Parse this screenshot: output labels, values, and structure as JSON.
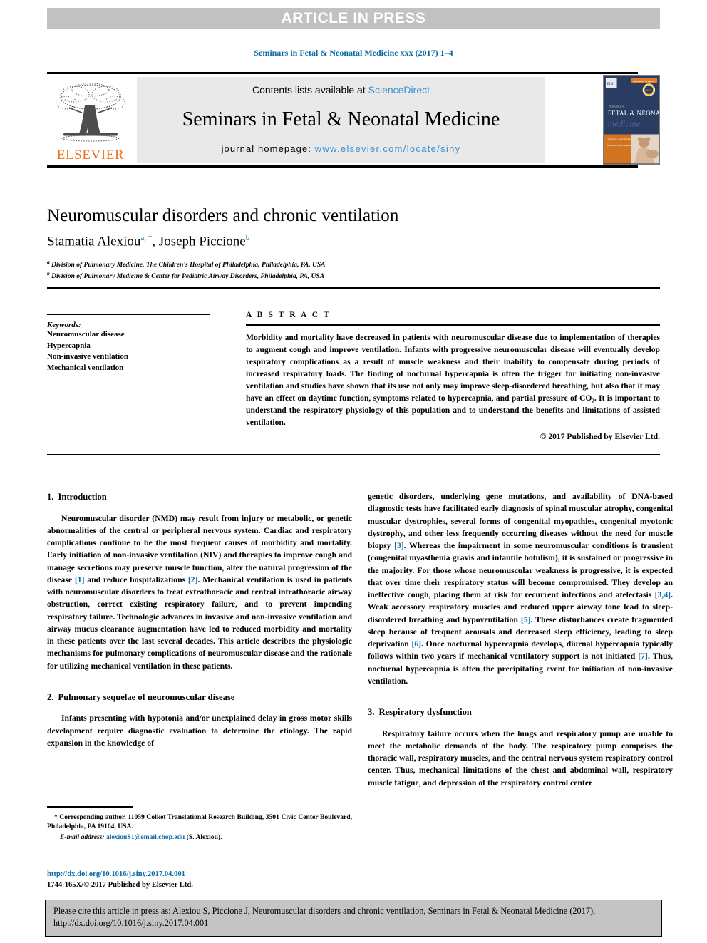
{
  "banner": {
    "text": "ARTICLE IN PRESS"
  },
  "running_head": {
    "text": "Seminars in Fetal & Neonatal Medicine xxx (2017) 1–4"
  },
  "masthead": {
    "contents_prefix": "Contents lists available at ",
    "contents_link": "ScienceDirect",
    "journal_name": "Seminars in Fetal & Neonatal Medicine",
    "homepage_label": "journal homepage: ",
    "homepage_url": "www.elsevier.com/locate/siny",
    "publisher_wordmark": "ELSEVIER",
    "cover_title_small": "Seminars in",
    "cover_title_main": "FETAL & NEONATAL",
    "cover_title_script": "medicine",
    "cover_band_text": "CHRONIC LUNG DISEASE",
    "cover_band_sub": "Guest Editor: Anne Greenough"
  },
  "article": {
    "title": "Neuromuscular disorders and chronic ventilation",
    "authors": [
      {
        "name": "Stamatia Alexiou",
        "marks": "a, *"
      },
      {
        "name": "Joseph Piccione",
        "marks": "b"
      }
    ],
    "affiliations": [
      {
        "mark": "a",
        "text": "Division of Pulmonary Medicine, The Children's Hospital of Philadelphia, Philadelphia, PA, USA"
      },
      {
        "mark": "b",
        "text": "Division of Pulmonary Medicine & Center for Pediatric Airway Disorders, Philadelphia, PA, USA"
      }
    ]
  },
  "keywords": {
    "heading": "Keywords:",
    "items": [
      "Neuromuscular disease",
      "Hypercapnia",
      "Non-invasive ventilation",
      "Mechanical ventilation"
    ]
  },
  "abstract": {
    "heading": "A B S T R A C T",
    "body": "Morbidity and mortality have decreased in patients with neuromuscular disease due to implementation of therapies to augment cough and improve ventilation. Infants with progressive neuromuscular disease will eventually develop respiratory complications as a result of muscle weakness and their inability to compensate during periods of increased respiratory loads. The finding of nocturnal hypercapnia is often the trigger for initiating non-invasive ventilation and studies have shown that its use not only may improve sleep-disordered breathing, but also that it may have an effect on daytime function, symptoms related to hypercapnia, and partial pressure of CO₂. It is important to understand the respiratory physiology of this population and to understand the benefits and limitations of assisted ventilation.",
    "copyright": "© 2017 Published by Elsevier Ltd."
  },
  "sections": {
    "intro": {
      "number": "1.",
      "title": "Introduction",
      "para1_a": "Neuromuscular disorder (NMD) may result from injury or metabolic, or genetic abnormalities of the central or peripheral nervous system. Cardiac and respiratory complications continue to be the most frequent causes of morbidity and mortality. Early initiation of non-invasive ventilation (NIV) and therapies to improve cough and manage secretions may preserve muscle function, alter the natural progression of the disease ",
      "ref1": "[1]",
      "para1_b": " and reduce hospitalizations ",
      "ref2": "[2]",
      "para1_c": ". Mechanical ventilation is used in patients with neuromuscular disorders to treat extrathoracic and central intrathoracic airway obstruction, correct existing respiratory failure, and to prevent impending respiratory failure. Technologic advances in invasive and non-invasive ventilation and airway mucus clearance augmentation have led to reduced morbidity and mortality in these patients over the last several decades. This article describes the physiologic mechanisms for pulmonary complications of neuromuscular disease and the rationale for utilizing mechanical ventilation in these patients."
    },
    "sequelae": {
      "number": "2.",
      "title": "Pulmonary sequelae of neuromuscular disease",
      "para1": "Infants presenting with hypotonia and/or unexplained delay in gross motor skills development require diagnostic evaluation to determine the etiology. The rapid expansion in the knowledge of"
    },
    "sequelae_cont": {
      "part_a": "genetic disorders, underlying gene mutations, and availability of DNA-based diagnostic tests have facilitated early diagnosis of spinal muscular atrophy, congenital muscular dystrophies, several forms of congenital myopathies, congenital myotonic dystrophy, and other less frequently occurring diseases without the need for muscle biopsy ",
      "ref3": "[3]",
      "part_b": ". Whereas the impairment in some neuromuscular conditions is transient (congenital myasthenia gravis and infantile botulism), it is sustained or progressive in the majority. For those whose neuromuscular weakness is progressive, it is expected that over time their respiratory status will become compromised. They develop an ineffective cough, placing them at risk for recurrent infections and atelectasis ",
      "ref34": "[3,4]",
      "part_c": ". Weak accessory respiratory muscles and reduced upper airway tone lead to sleep-disordered breathing and hypoventilation ",
      "ref5": "[5]",
      "part_d": ". These disturbances create fragmented sleep because of frequent arousals and decreased sleep efficiency, leading to sleep deprivation ",
      "ref6": "[6]",
      "part_e": ". Once nocturnal hypercapnia develops, diurnal hypercapnia typically follows within two years if mechanical ventilatory support is not initiated ",
      "ref7": "[7]",
      "part_f": ". Thus, nocturnal hypercapnia is often the precipitating event for initiation of non-invasive ventilation."
    },
    "resp_dysfunction": {
      "number": "3.",
      "title": "Respiratory dysfunction",
      "para1": "Respiratory failure occurs when the lungs and respiratory pump are unable to meet the metabolic demands of the body. The respiratory pump comprises the thoracic wall, respiratory muscles, and the central nervous system respiratory control center. Thus, mechanical limitations of the chest and abdominal wall, respiratory muscle fatigue, and depression of the respiratory control center"
    }
  },
  "footnote": {
    "corresponding": "* Corresponding author. 11059 Colket Translational Research Building, 3501 Civic Center Boulevard, Philadelphia, PA 19104, USA.",
    "email_label": "E-mail address:",
    "email": "alexiouS1@email.chop.edu",
    "email_suffix": "(S. Alexiou).",
    "doi_url": "http://dx.doi.org/10.1016/j.siny.2017.04.001",
    "issn_line": "1744-165X/© 2017 Published by Elsevier Ltd."
  },
  "cite_box": {
    "text": "Please cite this article in press as: Alexiou S, Piccione J, Neuromuscular disorders and chronic ventilation, Seminars in Fetal & Neonatal Medicine (2017), http://dx.doi.org/10.1016/j.siny.2017.04.001"
  },
  "colors": {
    "link_blue": "#0a6ba6",
    "sd_blue": "#3a8fd0",
    "elsevier_orange": "#e87722",
    "banner_gray": "#c2c2c2",
    "cite_gray": "#c4c4c4"
  }
}
